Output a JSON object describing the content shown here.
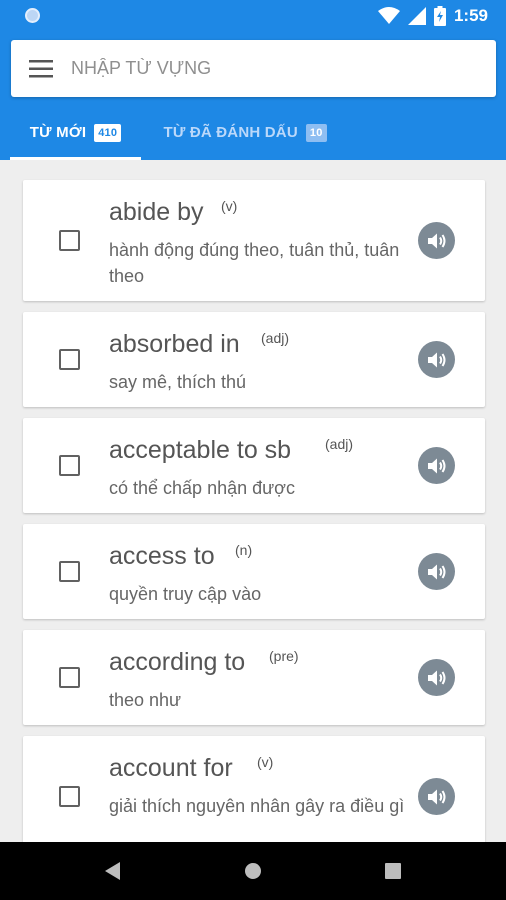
{
  "status_bar": {
    "time": "1:59",
    "icons": [
      "notification-dot-icon",
      "wifi-icon",
      "signal-icon",
      "battery-charging-icon"
    ]
  },
  "search": {
    "placeholder": "NHẬP TỪ VỰNG",
    "menu_icon": "menu-icon"
  },
  "tabs": [
    {
      "label": "TỪ MỚI",
      "badge": "410",
      "active": true
    },
    {
      "label": "TỪ ĐÃ ĐÁNH DẤU",
      "badge": "10",
      "active": false
    }
  ],
  "words": [
    {
      "word": "abide by",
      "pos": "(v)",
      "meaning": "hành động đúng theo, tuân thủ, tuân theo",
      "checked": false
    },
    {
      "word": "absorbed in",
      "pos": "(adj)",
      "meaning": "say mê, thích thú",
      "checked": false
    },
    {
      "word": "acceptable to sb",
      "pos": "(adj)",
      "meaning": "có thể chấp nhận được",
      "checked": false
    },
    {
      "word": "access to",
      "pos": "(n)",
      "meaning": "quyền truy cập vào",
      "checked": false
    },
    {
      "word": "according to",
      "pos": "(pre)",
      "meaning": "theo như",
      "checked": false
    },
    {
      "word": "account for",
      "pos": "(v)",
      "meaning": "giải thích nguyên nhân gây ra điều gì",
      "checked": false
    }
  ],
  "colors": {
    "primary": "#1e88e5",
    "background": "#eeeeee",
    "speaker": "#7d8a95"
  },
  "nav_bar": [
    "back-icon",
    "home-icon",
    "recents-icon"
  ]
}
